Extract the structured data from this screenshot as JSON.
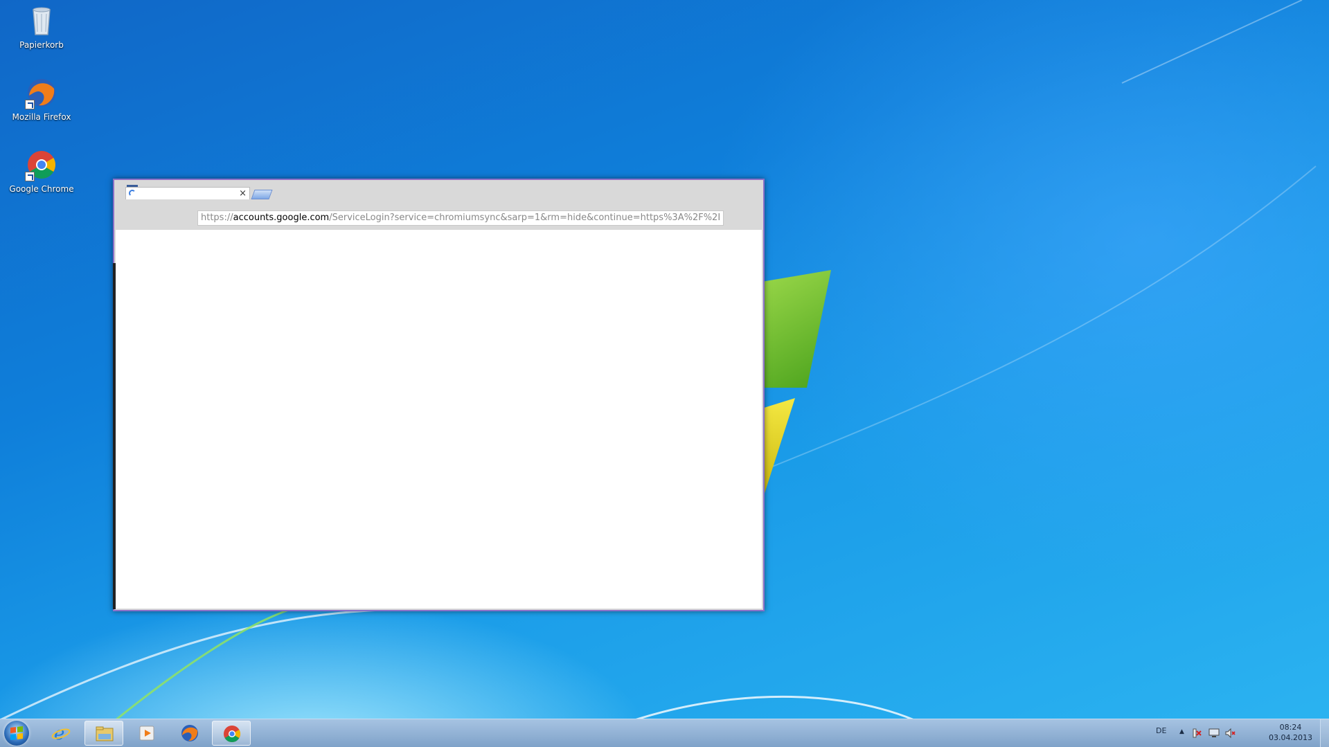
{
  "desktop": {
    "icons": [
      {
        "label": "Papierkorb",
        "icon": "recycle-bin-icon"
      },
      {
        "label": "Mozilla Firefox",
        "icon": "firefox-icon"
      },
      {
        "label": "Google Chrome",
        "icon": "chrome-icon"
      }
    ]
  },
  "browser": {
    "tab": {
      "close_glyph": "×",
      "loading": true
    },
    "url": {
      "scheme": "https://",
      "host": "accounts.google.com",
      "path": "/ServiceLogin?service=chromiumsync&sarp=1&rm=hide&continue=https%3A%2F%2I"
    }
  },
  "taskbar": {
    "pinned": [
      {
        "name": "internet-explorer",
        "icon": "internet-explorer-icon"
      },
      {
        "name": "windows-explorer",
        "icon": "folder-icon"
      },
      {
        "name": "media-player",
        "icon": "media-player-icon"
      },
      {
        "name": "firefox",
        "icon": "firefox-icon"
      },
      {
        "name": "chrome",
        "icon": "chrome-icon",
        "active": true
      }
    ],
    "tray": {
      "language": "DE",
      "overflow_glyph": "▲",
      "icons": [
        "action-center-icon",
        "network-icon",
        "volume-muted-icon"
      ]
    },
    "clock": {
      "time": "08:24",
      "date": "03.04.2013"
    }
  },
  "colors": {
    "window_border": "#8a6fc8",
    "taskbar": "#8fb0d6"
  }
}
